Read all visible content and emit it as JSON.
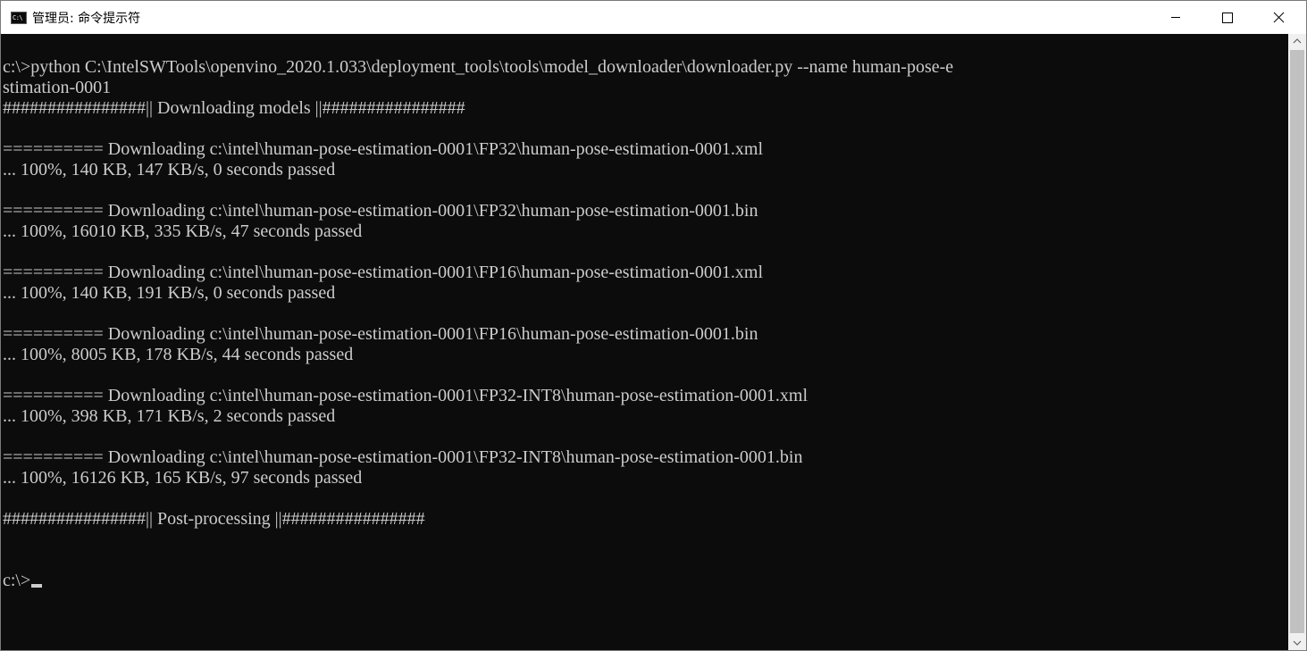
{
  "window": {
    "title": "管理员: 命令提示符",
    "app_icon_text": "C:\\"
  },
  "controls": {
    "minimize": "minimize-icon",
    "maximize": "maximize-icon",
    "close": "close-icon"
  },
  "console": {
    "lines": [
      "c:\\>python C:\\IntelSWTools\\openvino_2020.1.033\\deployment_tools\\tools\\model_downloader\\downloader.py --name human-pose-e",
      "stimation-0001",
      "################|| Downloading models ||################",
      "",
      "========== Downloading c:\\intel\\human-pose-estimation-0001\\FP32\\human-pose-estimation-0001.xml",
      "... 100%, 140 KB, 147 KB/s, 0 seconds passed",
      "",
      "========== Downloading c:\\intel\\human-pose-estimation-0001\\FP32\\human-pose-estimation-0001.bin",
      "... 100%, 16010 KB, 335 KB/s, 47 seconds passed",
      "",
      "========== Downloading c:\\intel\\human-pose-estimation-0001\\FP16\\human-pose-estimation-0001.xml",
      "... 100%, 140 KB, 191 KB/s, 0 seconds passed",
      "",
      "========== Downloading c:\\intel\\human-pose-estimation-0001\\FP16\\human-pose-estimation-0001.bin",
      "... 100%, 8005 KB, 178 KB/s, 44 seconds passed",
      "",
      "========== Downloading c:\\intel\\human-pose-estimation-0001\\FP32-INT8\\human-pose-estimation-0001.xml",
      "... 100%, 398 KB, 171 KB/s, 2 seconds passed",
      "",
      "========== Downloading c:\\intel\\human-pose-estimation-0001\\FP32-INT8\\human-pose-estimation-0001.bin",
      "... 100%, 16126 KB, 165 KB/s, 97 seconds passed",
      "",
      "################|| Post-processing ||################",
      "",
      ""
    ],
    "prompt": "c:\\>"
  },
  "colors": {
    "background": "#0c0c0c",
    "foreground": "#cccccc",
    "titlebar": "#ffffff",
    "scrollbar_track": "#f0f0f0",
    "scrollbar_thumb": "#c1c1c1"
  }
}
